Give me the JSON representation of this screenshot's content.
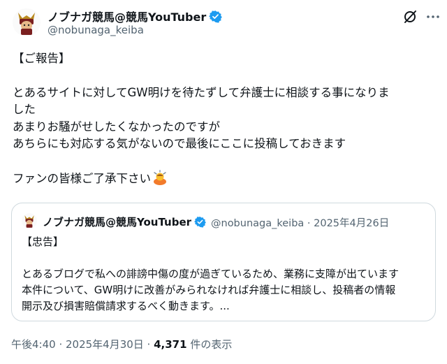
{
  "author": {
    "display_name": "ノブナガ競馬@競馬YouTuber",
    "handle": "@nobunaga_keiba"
  },
  "post": {
    "lines": [
      "【ご報告】",
      "",
      "とあるサイトに対してGW明けを待たずして弁護士に相談する事になりま",
      "した",
      "あまりお騒がせしたくなかったのですが",
      "あちらにも対応する気がないので最後にここに投稿しておきます",
      "",
      "ファンの皆様ご了承下さい"
    ],
    "emoji_name": "person-bowing"
  },
  "quoted_post": {
    "display_name": "ノブナガ競馬@競馬YouTuber",
    "meta": "@nobunaga_keiba · 2025年4月26日",
    "lines": [
      "【忠告】",
      "",
      "とあるブログで私への誹謗中傷の度が過ぎているため、業務に支障が出ています",
      "本件について、GW明けに改善がみられなければ弁護士に相談し、投稿者の情報",
      "開示及び損害賠償請求するべく動きます。..."
    ]
  },
  "footer": {
    "time": "午後4:40 · 2025年4月30日 · ",
    "views": "4,371",
    "views_suffix": " 件の表示"
  },
  "colors": {
    "verified": "#1d9bf0",
    "muted": "#536471",
    "text": "#0f1419",
    "border": "#cfd9de"
  }
}
